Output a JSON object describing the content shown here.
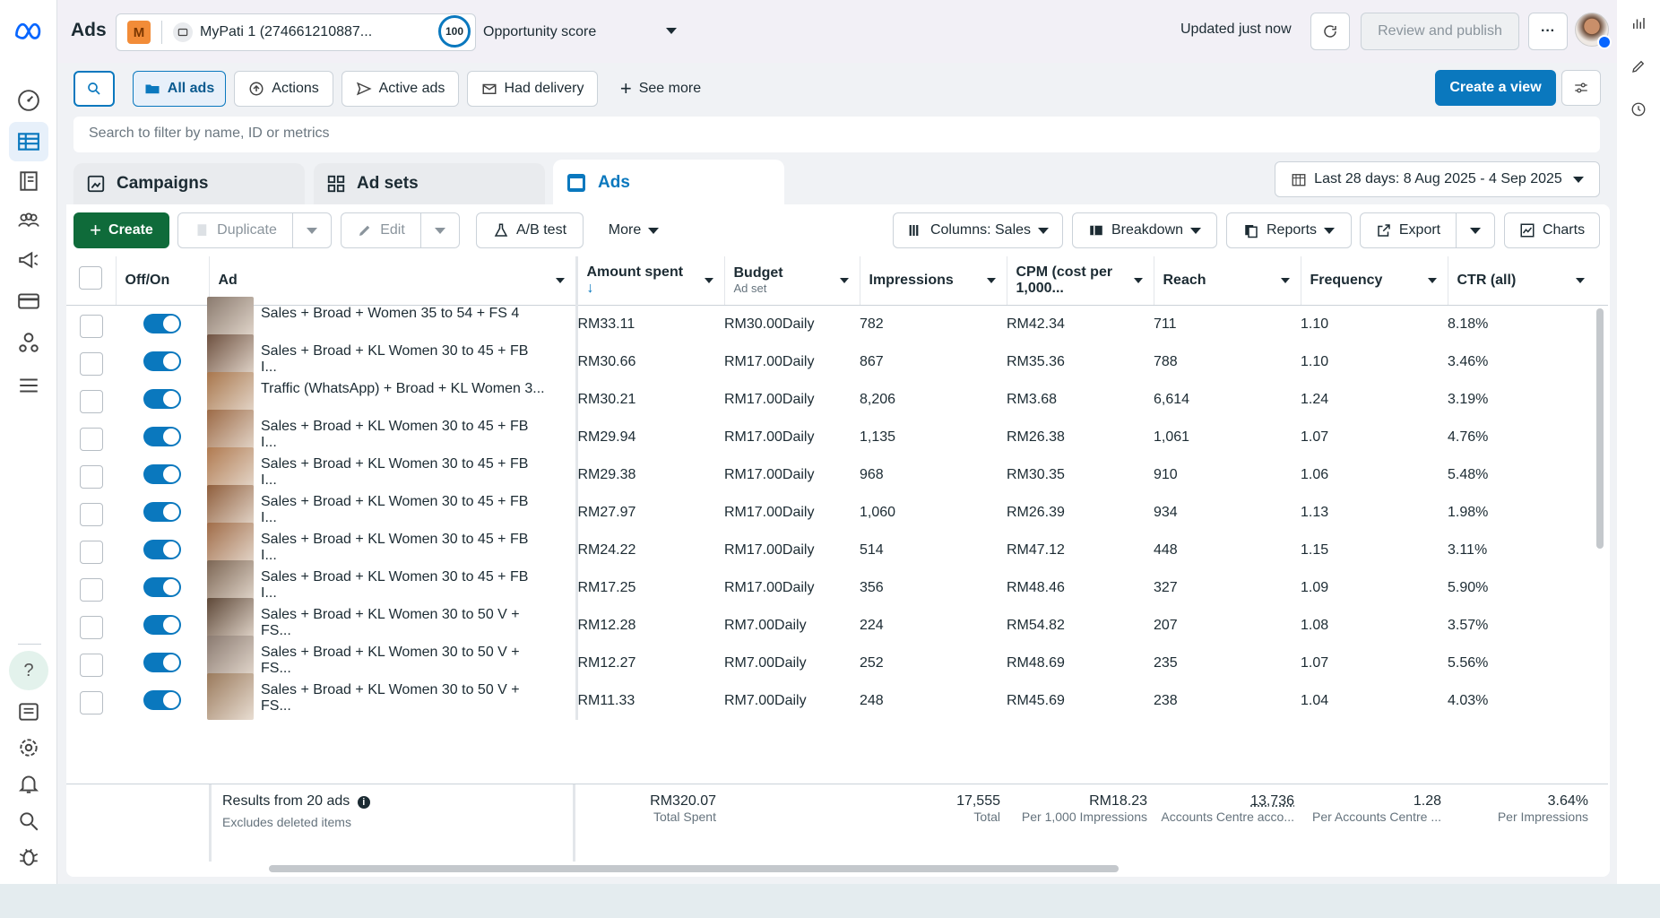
{
  "app": {
    "title": "Ads",
    "account_badge": "M",
    "account": "MyPati 1 (274661210887...",
    "score": "100",
    "score_label": "Opportunity score",
    "updated": "Updated just now",
    "review_publish": "Review and publish",
    "more_dots": "···"
  },
  "filters": {
    "all_ads": "All ads",
    "actions": "Actions",
    "active_ads": "Active ads",
    "had_delivery": "Had delivery",
    "see_more": "See more",
    "create_view": "Create a view",
    "search_placeholder": "Search to filter by name, ID or metrics"
  },
  "tabs": {
    "campaigns": "Campaigns",
    "ad_sets": "Ad sets",
    "ads": "Ads"
  },
  "date_range": "Last 28 days: 8 Aug 2025 - 4 Sep 2025",
  "toolbar": {
    "create": "Create",
    "duplicate": "Duplicate",
    "edit": "Edit",
    "ab_test": "A/B test",
    "more": "More",
    "columns": "Columns: Sales",
    "breakdown": "Breakdown",
    "reports": "Reports",
    "export": "Export",
    "charts": "Charts"
  },
  "columns": {
    "offon": "Off/On",
    "ad": "Ad",
    "amount": "Amount spent",
    "budget": "Budget",
    "budget_sub": "Ad set",
    "impressions": "Impressions",
    "cpm": "CPM (cost per 1,000...",
    "reach": "Reach",
    "frequency": "Frequency",
    "ctr": "CTR (all)"
  },
  "rows": [
    {
      "name": "Sales + Broad + Women 35 to 54 + FS 4",
      "amount": "RM33.11",
      "budget": "RM30.00",
      "period": "Daily",
      "impr": "782",
      "cpm": "RM42.34",
      "reach": "711",
      "freq": "1.10",
      "ctr": "8.18%"
    },
    {
      "name": "Sales + Broad + KL Women 30 to 45 + FB I...",
      "amount": "RM30.66",
      "budget": "RM17.00",
      "period": "Daily",
      "impr": "867",
      "cpm": "RM35.36",
      "reach": "788",
      "freq": "1.10",
      "ctr": "3.46%"
    },
    {
      "name": "Traffic (WhatsApp) + Broad + KL Women 3...",
      "amount": "RM30.21",
      "budget": "RM17.00",
      "period": "Daily",
      "impr": "8,206",
      "cpm": "RM3.68",
      "reach": "6,614",
      "freq": "1.24",
      "ctr": "3.19%"
    },
    {
      "name": "Sales + Broad + KL Women 30 to 45 + FB I...",
      "amount": "RM29.94",
      "budget": "RM17.00",
      "period": "Daily",
      "impr": "1,135",
      "cpm": "RM26.38",
      "reach": "1,061",
      "freq": "1.07",
      "ctr": "4.76%"
    },
    {
      "name": "Sales + Broad + KL Women 30 to 45 + FB I...",
      "amount": "RM29.38",
      "budget": "RM17.00",
      "period": "Daily",
      "impr": "968",
      "cpm": "RM30.35",
      "reach": "910",
      "freq": "1.06",
      "ctr": "5.48%"
    },
    {
      "name": "Sales + Broad + KL Women 30 to 45 + FB I...",
      "amount": "RM27.97",
      "budget": "RM17.00",
      "period": "Daily",
      "impr": "1,060",
      "cpm": "RM26.39",
      "reach": "934",
      "freq": "1.13",
      "ctr": "1.98%"
    },
    {
      "name": "Sales + Broad + KL Women 30 to 45 + FB I...",
      "amount": "RM24.22",
      "budget": "RM17.00",
      "period": "Daily",
      "impr": "514",
      "cpm": "RM47.12",
      "reach": "448",
      "freq": "1.15",
      "ctr": "3.11%"
    },
    {
      "name": "Sales + Broad + KL Women 30 to 45 + FB I...",
      "amount": "RM17.25",
      "budget": "RM17.00",
      "period": "Daily",
      "impr": "356",
      "cpm": "RM48.46",
      "reach": "327",
      "freq": "1.09",
      "ctr": "5.90%"
    },
    {
      "name": "Sales + Broad + KL Women 30 to 50 V + FS...",
      "amount": "RM12.28",
      "budget": "RM7.00",
      "period": "Daily",
      "impr": "224",
      "cpm": "RM54.82",
      "reach": "207",
      "freq": "1.08",
      "ctr": "3.57%"
    },
    {
      "name": "Sales + Broad + KL Women 30 to 50 V + FS...",
      "amount": "RM12.27",
      "budget": "RM7.00",
      "period": "Daily",
      "impr": "252",
      "cpm": "RM48.69",
      "reach": "235",
      "freq": "1.07",
      "ctr": "5.56%"
    },
    {
      "name": "Sales + Broad + KL Women 30 to 50 V + FS...",
      "amount": "RM11.33",
      "budget": "RM7.00",
      "period": "Daily",
      "impr": "248",
      "cpm": "RM45.69",
      "reach": "238",
      "freq": "1.04",
      "ctr": "4.03%"
    }
  ],
  "totals": {
    "label": "Results from 20 ads",
    "sub": "Excludes deleted items",
    "amount": "RM320.07",
    "amount_sub": "Total Spent",
    "impr": "17,555",
    "impr_sub": "Total",
    "cpm": "RM18.23",
    "cpm_sub": "Per 1,000 Impressions",
    "reach": "13,736",
    "reach_sub": "Accounts Centre acco...",
    "freq": "1.28",
    "freq_sub": "Per Accounts Centre ...",
    "ctr": "3.64%",
    "ctr_sub": "Per Impressions"
  },
  "colors": {
    "accent": "#0a78be",
    "create_green": "#0f6b3a"
  }
}
